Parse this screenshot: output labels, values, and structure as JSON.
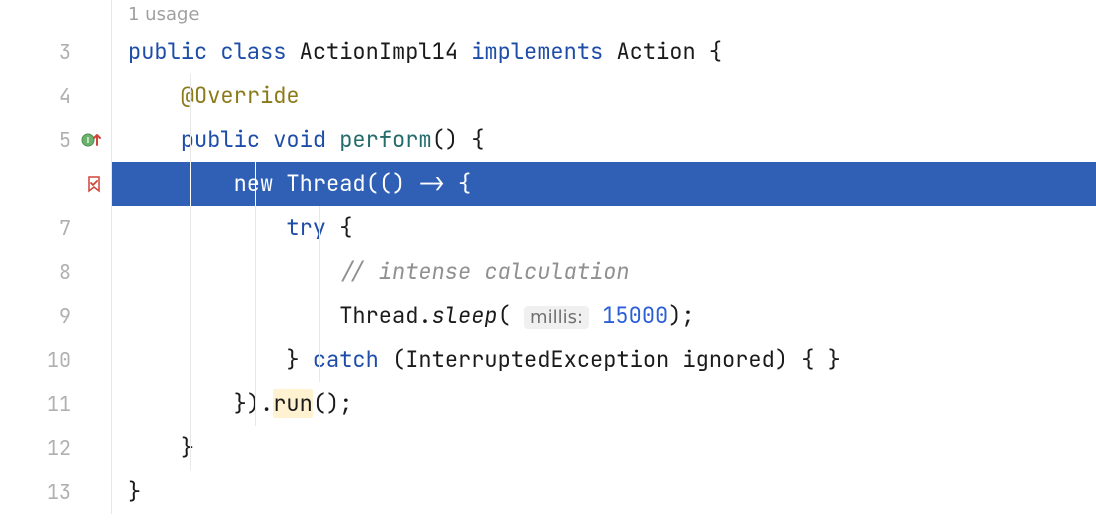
{
  "usage_hint": "1 usage",
  "lines": {
    "l3_num": "3",
    "l4_num": "4",
    "l5_num": "5",
    "l7_num": "7",
    "l8_num": "8",
    "l9_num": "9",
    "l10_num": "10",
    "l11_num": "11",
    "l12_num": "12",
    "l13_num": "13"
  },
  "code": {
    "l3": {
      "kw_public": "public",
      "kw_class": "class",
      "classname": "ActionImpl14",
      "kw_implements": "implements",
      "iface": "Action",
      "brace": " {"
    },
    "l4": {
      "annotation": "@Override"
    },
    "l5": {
      "kw_public": "public",
      "kw_void": "void",
      "method": "perform",
      "tail": "() {"
    },
    "l6": {
      "kw_new": "new",
      "type": "Thread",
      "tail": "(() -> {"
    },
    "l7": {
      "kw_try": "try",
      "tail": " {"
    },
    "l8": {
      "comment": "// intense calculation"
    },
    "l9": {
      "receiver": "Thread.",
      "method": "sleep",
      "open": "(",
      "hint": "millis:",
      "sp": " ",
      "number": "15000",
      "close": ");"
    },
    "l10": {
      "close1": "} ",
      "kw_catch": "catch",
      "paren": " (InterruptedException ignored) { }"
    },
    "l11": {
      "close": "}).",
      "method": "run",
      "tail": "();"
    },
    "l12": {
      "brace": "}"
    },
    "l13": {
      "brace": "}"
    }
  },
  "icons": {
    "interface_marker": "interface-implemented-icon",
    "override_marker": "override-up-icon",
    "bookmark": "bookmark-check-icon"
  },
  "colors": {
    "selection": "#2f60b6",
    "keyword": "#1e4da8",
    "annotation": "#8a7a1a",
    "comment": "#909090",
    "number": "#2b5fd6"
  }
}
